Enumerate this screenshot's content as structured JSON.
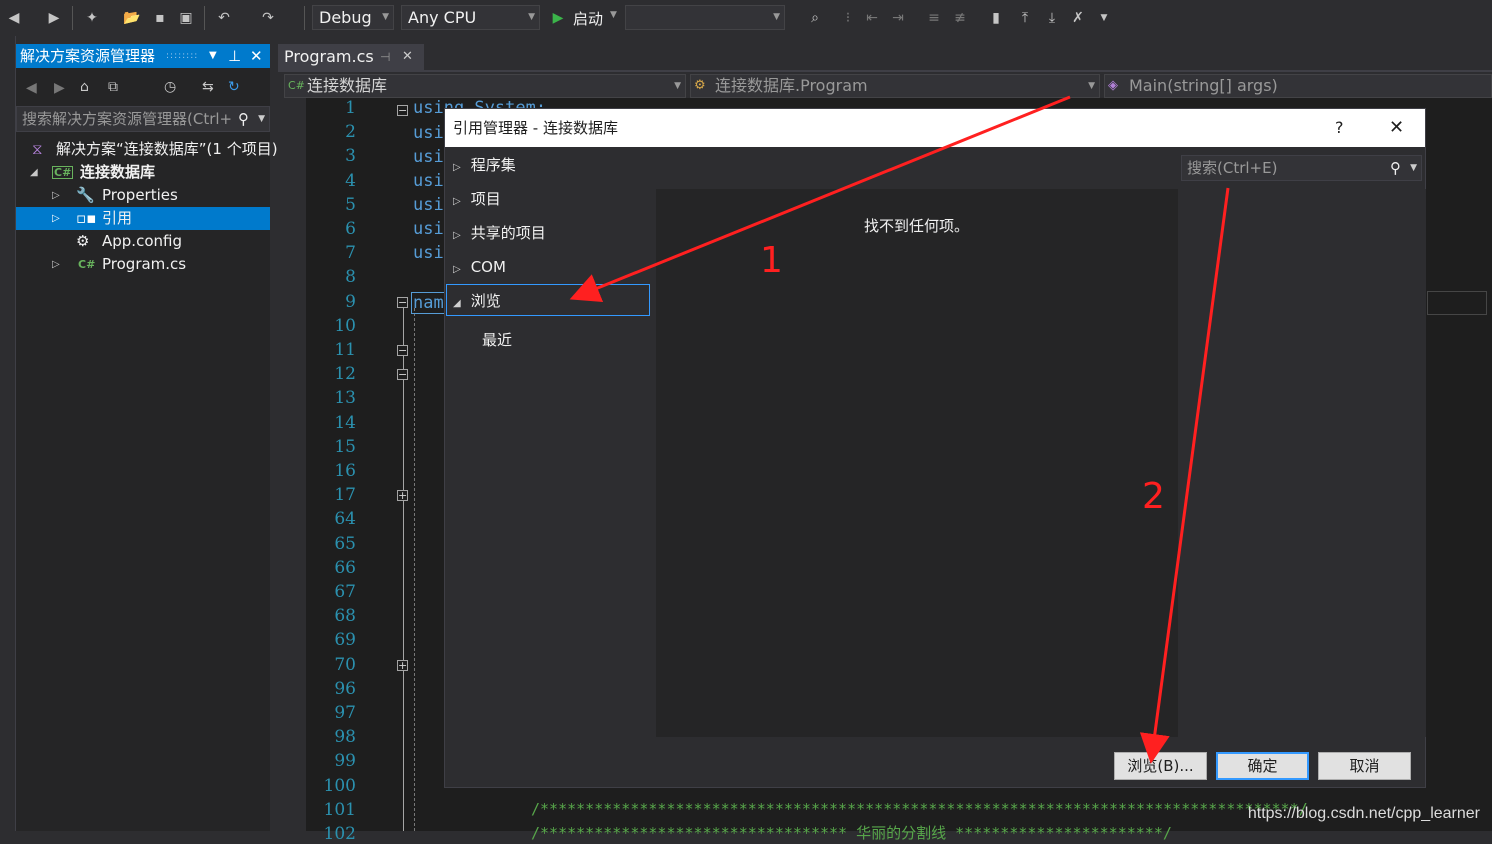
{
  "toolbar": {
    "config": "Debug",
    "platform": "Any CPU",
    "start": "启动"
  },
  "solution_explorer": {
    "title": "解决方案资源管理器",
    "search_placeholder": "搜索解决方案资源管理器(Ctrl+",
    "tree": [
      {
        "label": "解决方案“连接数据库”(1 个项目)"
      },
      {
        "label": "连接数据库"
      },
      {
        "label": "Properties"
      },
      {
        "label": "引用"
      },
      {
        "label": "App.config"
      },
      {
        "label": "Program.cs"
      }
    ]
  },
  "editor": {
    "tab": "Program.cs",
    "nav": {
      "project": "连接数据库",
      "class": "连接数据库.Program",
      "member": "Main(string[] args)"
    },
    "line_numbers": [
      "1",
      "2",
      "3",
      "4",
      "5",
      "6",
      "7",
      "8",
      "9",
      "10",
      "11",
      "12",
      "13",
      "14",
      "15",
      "16",
      "17",
      "64",
      "65",
      "66",
      "67",
      "68",
      "69",
      "70",
      "96",
      "97",
      "98",
      "99",
      "100",
      "101",
      "102"
    ],
    "code_fragments": [
      "using System;",
      "usi",
      "usi",
      "usi",
      "usi",
      "usi",
      "usi",
      "nam"
    ],
    "comment_line": "/************************************************************************************/",
    "comment_line2": "/**********************************    华丽的分割线    ***********************/"
  },
  "dialog": {
    "title": "引用管理器 - 连接数据库",
    "help": "?",
    "close": "✕",
    "categories": [
      "程序集",
      "项目",
      "共享的项目",
      "COM",
      "浏览"
    ],
    "sub_category": "最近",
    "empty_message": "找不到任何项。",
    "search_placeholder": "搜索(Ctrl+E)",
    "buttons": {
      "browse": "浏览(B)...",
      "ok": "确定",
      "cancel": "取消"
    }
  },
  "annotations": {
    "one": "1",
    "two": "2",
    "color": "#ff2020"
  },
  "watermark": "https://blog.csdn.net/cpp_learner"
}
